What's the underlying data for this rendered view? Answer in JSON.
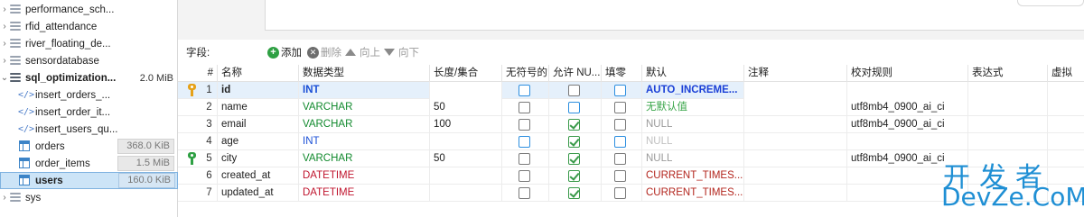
{
  "tree": {
    "items": [
      {
        "label": "performance_sch...",
        "kind": "db"
      },
      {
        "label": "rfid_attendance",
        "kind": "db"
      },
      {
        "label": "river_floating_de...",
        "kind": "db"
      },
      {
        "label": "sensordatabase",
        "kind": "db"
      },
      {
        "label": "sql_optimization...",
        "kind": "db-open",
        "size": "2.0 MiB"
      },
      {
        "label": "insert_orders_...",
        "kind": "routine"
      },
      {
        "label": "insert_order_it...",
        "kind": "routine"
      },
      {
        "label": "insert_users_qu...",
        "kind": "routine"
      },
      {
        "label": "orders",
        "kind": "table",
        "size": "368.0 KiB"
      },
      {
        "label": "order_items",
        "kind": "table",
        "size": "1.5 MiB"
      },
      {
        "label": "users",
        "kind": "table",
        "size": "160.0 KiB",
        "selected": true
      },
      {
        "label": "sys",
        "kind": "db"
      }
    ]
  },
  "toolbar": {
    "fields_label": "字段:",
    "add_label": "添加",
    "delete_label": "删除",
    "up_label": "向上",
    "down_label": "向下"
  },
  "grid": {
    "headers": [
      "#",
      "名称",
      "数据类型",
      "长度/集合",
      "无符号的",
      "允许 NU...",
      "填零",
      "默认",
      "注释",
      "校对规则",
      "表达式",
      "虚拟"
    ],
    "rows": [
      {
        "num": "1",
        "name": "id",
        "type": "INT",
        "length": "",
        "unsigned": "unchecked-blue",
        "nullable": "unchecked",
        "zerofill": "unchecked-blue",
        "default": "AUTO_INCREME...",
        "comment": "",
        "collation": "",
        "key": "primary"
      },
      {
        "num": "2",
        "name": "name",
        "type": "VARCHAR",
        "length": "50",
        "unsigned": "unchecked",
        "nullable": "unchecked-blue",
        "zerofill": "unchecked",
        "default": "无默认值",
        "comment": "",
        "collation": "utf8mb4_0900_ai_ci",
        "key": ""
      },
      {
        "num": "3",
        "name": "email",
        "type": "VARCHAR",
        "length": "100",
        "unsigned": "unchecked",
        "nullable": "checked",
        "zerofill": "unchecked",
        "default": "NULL",
        "comment": "",
        "collation": "utf8mb4_0900_ai_ci",
        "key": ""
      },
      {
        "num": "4",
        "name": "age",
        "type": "INT",
        "length": "",
        "unsigned": "unchecked-blue",
        "nullable": "checked",
        "zerofill": "unchecked-blue",
        "default": "NULL",
        "comment": "",
        "collation": "",
        "key": ""
      },
      {
        "num": "5",
        "name": "city",
        "type": "VARCHAR",
        "length": "50",
        "unsigned": "unchecked",
        "nullable": "checked",
        "zerofill": "unchecked",
        "default": "NULL",
        "comment": "",
        "collation": "utf8mb4_0900_ai_ci",
        "key": "index"
      },
      {
        "num": "6",
        "name": "created_at",
        "type": "DATETIME",
        "length": "",
        "unsigned": "unchecked",
        "nullable": "checked",
        "zerofill": "unchecked",
        "default": "CURRENT_TIMES...",
        "comment": "",
        "collation": "",
        "key": ""
      },
      {
        "num": "7",
        "name": "updated_at",
        "type": "DATETIME",
        "length": "",
        "unsigned": "unchecked",
        "nullable": "checked",
        "zerofill": "unchecked",
        "default": "CURRENT_TIMES...",
        "comment": "",
        "collation": "",
        "key": ""
      }
    ]
  },
  "watermark": {
    "line1": "开发者",
    "line2": "DevZe.CoM"
  },
  "colors": {
    "accent": "#1f8fd4",
    "selection": "#cce4f7",
    "int_type": "#1a4fd6",
    "varchar_type": "#128a2e",
    "datetime_type": "#c0152e"
  }
}
